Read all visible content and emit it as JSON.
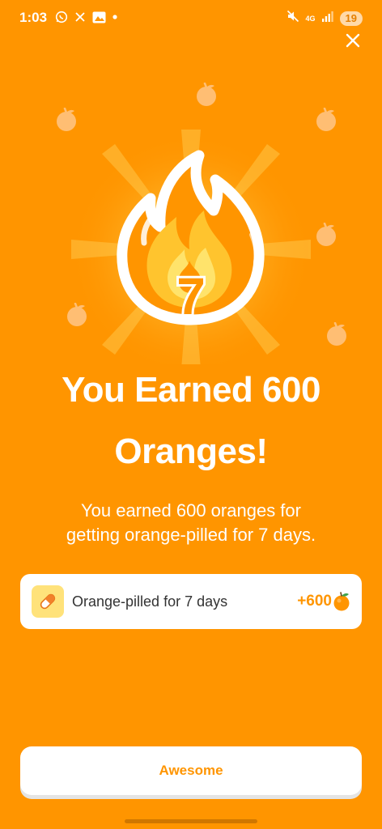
{
  "status_bar": {
    "time": "1:03",
    "network": "4G",
    "battery": "19"
  },
  "hero": {
    "streak_number": "7"
  },
  "headline": {
    "line1": "You Earned 600",
    "line2": "Oranges!"
  },
  "subtext": {
    "line1": "You earned 600 oranges for",
    "line2": "getting orange-pilled for 7 days."
  },
  "reward": {
    "icon": "pill-icon",
    "label": "Orange-pilled for 7 days",
    "amount": "+600",
    "amount_icon": "orange-icon"
  },
  "actions": {
    "primary_label": "Awesome"
  },
  "colors": {
    "background": "#FF9500",
    "accent": "#FF9500",
    "card": "#FFFFFF",
    "pill_icon_bg": "#FFE27A"
  }
}
